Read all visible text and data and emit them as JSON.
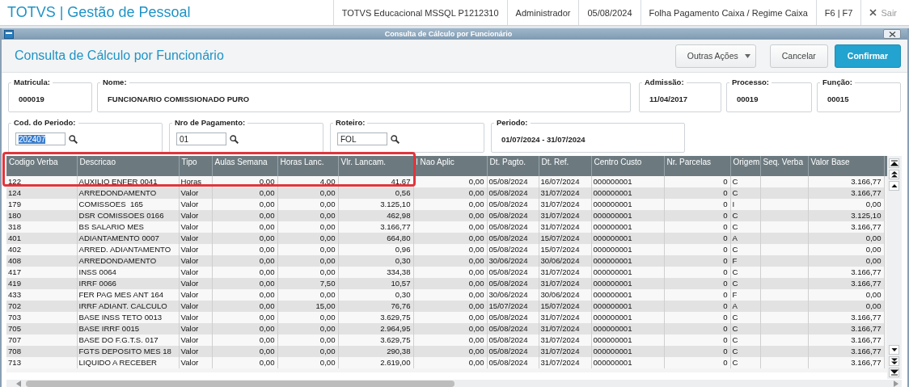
{
  "app": {
    "title": "TOTVS | Gestão de Pessoal",
    "status": [
      "TOTVS Educacional MSSQL P1212310",
      "Administrador",
      "05/08/2024",
      "Folha Pagamento Caixa / Regime Caixa",
      "F6 | F7"
    ],
    "exit": "Sair"
  },
  "window": {
    "title": "Consulta de Cálculo por Funcionário"
  },
  "page": {
    "title": "Consulta de Cálculo por Funcionário",
    "buttons": [
      {
        "label": "Outras Ações",
        "kind": "menu"
      },
      {
        "label": "Cancelar",
        "kind": "default"
      },
      {
        "label": "Confirmar",
        "kind": "primary"
      }
    ]
  },
  "field_rows": [
    [
      {
        "label": "Matricula:",
        "value": "000019",
        "kind": "display"
      },
      {
        "label": "Nome:",
        "value": "FUNCIONARIO COMISSIONADO PURO",
        "kind": "display"
      },
      {
        "label": "Admissão:",
        "value": "11/04/2017",
        "kind": "display"
      },
      {
        "label": "Processo:",
        "value": "00019",
        "kind": "display"
      },
      {
        "label": "Função:",
        "value": "00015",
        "kind": "display"
      }
    ],
    [
      {
        "label": "Cod. do Periodo:",
        "value": "202407",
        "kind": "input",
        "selected": true
      },
      {
        "label": "Nro de Pagamento:",
        "value": "01",
        "kind": "input",
        "selected": false
      },
      {
        "label": "Roteiro:",
        "value": "FOL",
        "kind": "input",
        "selected": false
      },
      {
        "label": "Periodo:",
        "value": "01/07/2024 - 31/07/2024",
        "kind": "display"
      }
    ]
  ],
  "table": {
    "columns": [
      {
        "label": "Codigo Verba",
        "kind": "text"
      },
      {
        "label": "Descricao",
        "kind": "text"
      },
      {
        "label": "Tipo",
        "kind": "text"
      },
      {
        "label": "Aulas Semana",
        "kind": "number"
      },
      {
        "label": "Horas Lanc.",
        "kind": "number"
      },
      {
        "label": "Vlr. Lancam.",
        "kind": "number"
      },
      {
        "label": "l Nao Aplic",
        "kind": "number"
      },
      {
        "label": "Dt. Pagto.",
        "kind": "text"
      },
      {
        "label": "Dt. Ref.",
        "kind": "text"
      },
      {
        "label": "Centro Custo",
        "kind": "text"
      },
      {
        "label": "Nr. Parcelas",
        "kind": "number"
      },
      {
        "label": "Origem",
        "kind": "text"
      },
      {
        "label": "Seq. Verba",
        "kind": "text"
      },
      {
        "label": "Valor Base",
        "kind": "number"
      }
    ],
    "rows": [
      {
        "highlighted": true,
        "cells": [
          "122",
          "AUXILIO ENFER 0041",
          "Horas",
          "0,00",
          "4,00",
          "41,67",
          "0,00",
          "05/08/2024",
          "16/07/2024",
          "000000001",
          "0",
          "C",
          "",
          "3.166,77"
        ]
      },
      {
        "highlighted": false,
        "cells": [
          "124",
          "ARREDONDAMENTO",
          "Valor",
          "0,00",
          "0,00",
          "0,56",
          "0,00",
          "05/08/2024",
          "31/07/2024",
          "000000001",
          "0",
          "C",
          "",
          "3.166,77"
        ]
      },
      {
        "highlighted": false,
        "cells": [
          "179",
          "COMISSOES  165",
          "Valor",
          "0,00",
          "0,00",
          "3.125,10",
          "0,00",
          "05/08/2024",
          "31/07/2024",
          "000000001",
          "0",
          "I",
          "",
          "0,00"
        ]
      },
      {
        "highlighted": false,
        "cells": [
          "180",
          "DSR COMISSOES 0166",
          "Valor",
          "0,00",
          "0,00",
          "462,98",
          "0,00",
          "05/08/2024",
          "31/07/2024",
          "000000001",
          "0",
          "C",
          "",
          "3.125,10"
        ]
      },
      {
        "highlighted": false,
        "cells": [
          "318",
          "BS SALARIO MES",
          "Valor",
          "0,00",
          "0,00",
          "3.166,77",
          "0,00",
          "05/08/2024",
          "31/07/2024",
          "000000001",
          "0",
          "C",
          "",
          "3.166,77"
        ]
      },
      {
        "highlighted": false,
        "cells": [
          "401",
          "ADIANTAMENTO 0007",
          "Valor",
          "0,00",
          "0,00",
          "664,80",
          "0,00",
          "05/08/2024",
          "15/07/2024",
          "000000001",
          "0",
          "A",
          "",
          "0,00"
        ]
      },
      {
        "highlighted": false,
        "cells": [
          "402",
          "ARRED. ADIANTAMENTO",
          "Valor",
          "0,00",
          "0,00",
          "0,96",
          "0,00",
          "05/08/2024",
          "15/07/2024",
          "000000001",
          "0",
          "C",
          "",
          "0,00"
        ]
      },
      {
        "highlighted": false,
        "cells": [
          "408",
          "ARREDONDAMENTO",
          "Valor",
          "0,00",
          "0,00",
          "0,30",
          "0,00",
          "30/06/2024",
          "30/06/2024",
          "000000001",
          "0",
          "F",
          "",
          "0,00"
        ]
      },
      {
        "highlighted": false,
        "cells": [
          "417",
          "INSS 0064",
          "Valor",
          "0,00",
          "0,00",
          "334,38",
          "0,00",
          "05/08/2024",
          "31/07/2024",
          "000000001",
          "0",
          "C",
          "",
          "3.166,77"
        ]
      },
      {
        "highlighted": false,
        "cells": [
          "419",
          "IRRF 0066",
          "Valor",
          "0,00",
          "7,50",
          "10,57",
          "0,00",
          "05/08/2024",
          "31/07/2024",
          "000000001",
          "0",
          "C",
          "",
          "3.166,77"
        ]
      },
      {
        "highlighted": false,
        "cells": [
          "433",
          "FER PAG MES ANT 164",
          "Valor",
          "0,00",
          "0,00",
          "0,30",
          "0,00",
          "30/06/2024",
          "30/06/2024",
          "000000001",
          "0",
          "F",
          "",
          "0,00"
        ]
      },
      {
        "highlighted": false,
        "cells": [
          "702",
          "IRRF ADIANT. CALCULO",
          "Valor",
          "0,00",
          "15,00",
          "76,76",
          "0,00",
          "15/07/2024",
          "15/07/2024",
          "000000001",
          "0",
          "A",
          "",
          "0,00"
        ]
      },
      {
        "highlighted": false,
        "cells": [
          "703",
          "BASE INSS TETO 0013",
          "Valor",
          "0,00",
          "0,00",
          "3.629,75",
          "0,00",
          "05/08/2024",
          "31/07/2024",
          "000000001",
          "0",
          "C",
          "",
          "3.166,77"
        ]
      },
      {
        "highlighted": false,
        "cells": [
          "705",
          "BASE IRRF 0015",
          "Valor",
          "0,00",
          "0,00",
          "2.964,95",
          "0,00",
          "05/08/2024",
          "31/07/2024",
          "000000001",
          "0",
          "C",
          "",
          "3.166,77"
        ]
      },
      {
        "highlighted": false,
        "cells": [
          "707",
          "BASE DO F.G.T.S. 017",
          "Valor",
          "0,00",
          "0,00",
          "3.629,75",
          "0,00",
          "05/08/2024",
          "31/07/2024",
          "000000001",
          "0",
          "C",
          "",
          "3.166,77"
        ]
      },
      {
        "highlighted": false,
        "cells": [
          "708",
          "FGTS DEPOSITO MES 18",
          "Valor",
          "0,00",
          "0,00",
          "290,38",
          "0,00",
          "05/08/2024",
          "31/07/2024",
          "000000001",
          "0",
          "C",
          "",
          "3.166,77"
        ]
      },
      {
        "highlighted": false,
        "cells": [
          "713",
          "LIQUIDO A RECEBER",
          "Valor",
          "0,00",
          "0,00",
          "2.619,00",
          "0,00",
          "05/08/2024",
          "31/07/2024",
          "000000001",
          "0",
          "C",
          "",
          "3.166,77"
        ]
      }
    ]
  }
}
